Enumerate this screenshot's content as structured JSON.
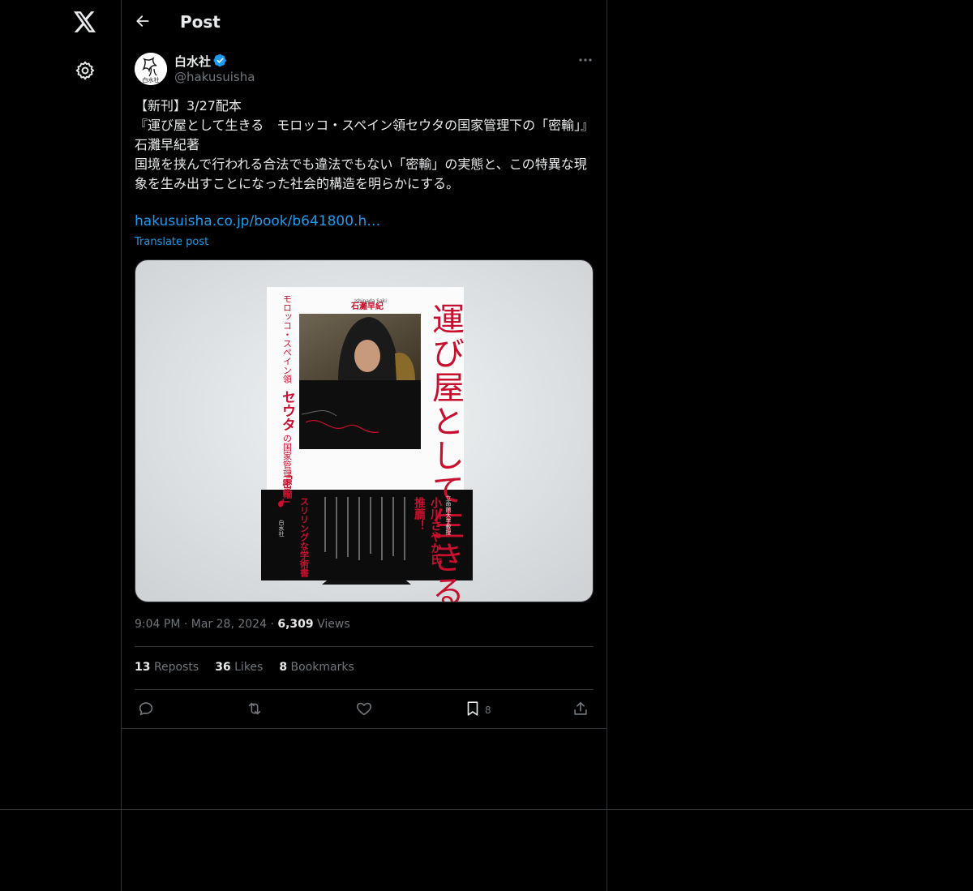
{
  "nav": {
    "logo_icon": "x-logo-icon",
    "settings_icon": "gear-icon"
  },
  "header": {
    "title": "Post",
    "back_icon": "arrow-left-icon"
  },
  "author": {
    "name": "白水社",
    "handle": "@hakusuisha",
    "verified": true,
    "avatar_text": "白水社"
  },
  "tweet": {
    "text": "【新刊】3/27配本\n『運び屋として生きる　モロッコ・スペイン領セウタの国家管理下の「密輸」』\n石灘早紀著\n国境を挟んで行われる合法でも違法でもない「密輸」の実態と、この特異な現象を生み出すことになった社会的構造を明らかにする。",
    "link": "hakusuisha.co.jp/book/b641800.h…",
    "translate_label": "Translate post"
  },
  "media": {
    "book_title": "運び屋として生きる",
    "book_author": "石灘早紀",
    "book_author_roman": "Ishinada Saki",
    "book_subtitle_a": "モロッコ・スペイン領",
    "book_subtitle_b": "セウタ",
    "book_subtitle_c": "の国家管理下の",
    "book_subtitle_d": "「密輸」",
    "obi_recommender": "小川さやか氏",
    "obi_recommender_title": "立命館大学教授",
    "obi_recommend": "推薦！",
    "obi_tagline": "スリリングな学術書",
    "publisher": "白水社",
    "colors": {
      "title_red": "#c8102e",
      "background": "#dfe2e5"
    }
  },
  "meta": {
    "time": "9:04 PM",
    "date": "Mar 28, 2024",
    "views_count": "6,309",
    "views_label": "Views"
  },
  "stats": {
    "reposts_count": "13",
    "reposts_label": "Reposts",
    "likes_count": "36",
    "likes_label": "Likes",
    "bookmarks_count": "8",
    "bookmarks_label": "Bookmarks"
  },
  "actions": {
    "bookmark_count": "8"
  },
  "colors": {
    "accent": "#1d9bf0",
    "border": "#2f3336",
    "muted": "#71767b",
    "text": "#e7e9ea"
  }
}
